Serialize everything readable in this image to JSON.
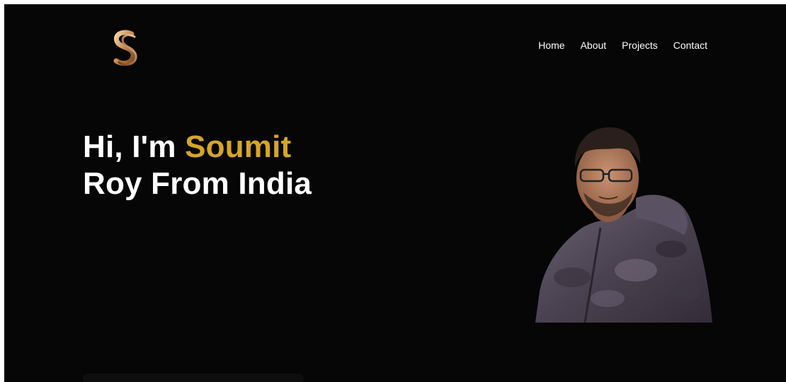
{
  "brand": {
    "logo_icon": "s-monogram-logo-icon",
    "gold": "#d4a52c"
  },
  "nav": {
    "items": [
      {
        "label": "Home"
      },
      {
        "label": "About"
      },
      {
        "label": "Projects"
      },
      {
        "label": "Contact"
      }
    ]
  },
  "hero": {
    "line1_prefix": "Hi, I'm ",
    "name_accent": "Soumit",
    "line2": "Roy From India"
  },
  "colors": {
    "background": "#060606",
    "text": "#ffffff",
    "accent": "#d4a52c"
  }
}
